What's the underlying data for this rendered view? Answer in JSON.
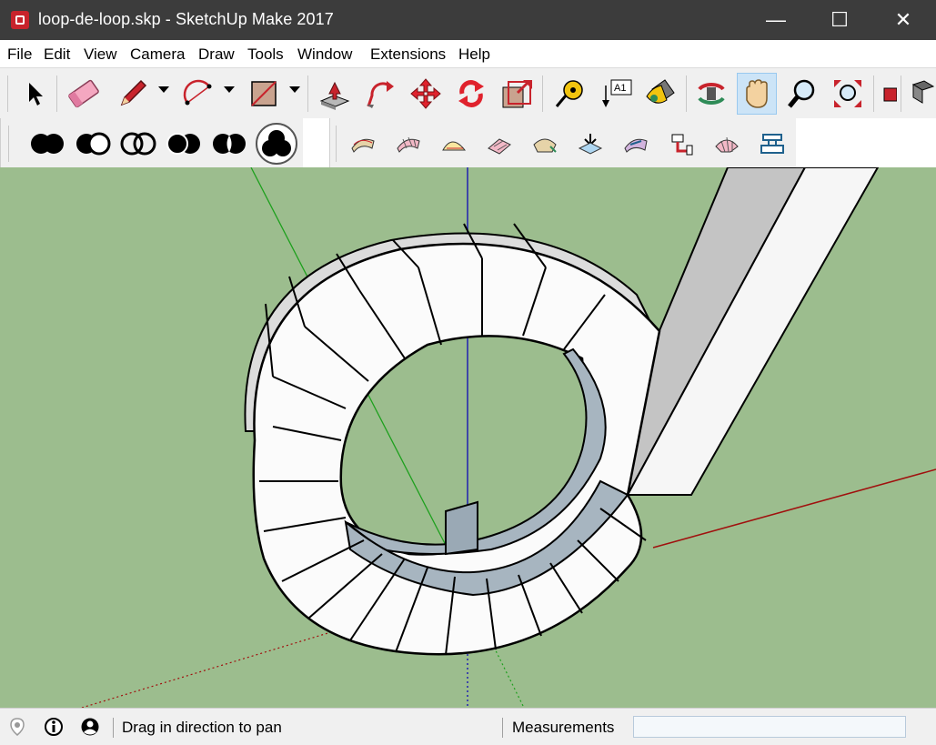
{
  "window": {
    "title": "loop-de-loop.skp - SketchUp Make 2017",
    "minimize_glyph": "—",
    "maximize_glyph": "☐",
    "close_glyph": "✕"
  },
  "menu": [
    "File",
    "Edit",
    "View",
    "Camera",
    "Draw",
    "Tools",
    "Window",
    "Extensions",
    "Help"
  ],
  "toolbar_main": [
    "select-icon",
    "eraser-icon",
    "pencil-icon",
    "arc-icon",
    "rectangle-icon",
    "push-pull-icon",
    "follow-me-icon",
    "move-icon",
    "rotate-icon",
    "offset-icon",
    "tape-measure-icon",
    "text-icon",
    "paint-bucket-icon",
    "orbit-icon",
    "pan-icon",
    "zoom-icon",
    "zoom-extents-icon"
  ],
  "active_tool": "pan-icon",
  "toolbar_solid": [
    "union-icon",
    "subtract-icon",
    "intersect-icon",
    "trim-icon",
    "split-icon",
    "outer-shell-icon"
  ],
  "toolbar_sandbox": [
    "from-contours-icon",
    "from-scratch-icon",
    "smoove-icon",
    "stamp-icon",
    "drape-icon",
    "add-detail-icon",
    "flip-edge-icon",
    "plumbing-icon",
    "mesh-icon",
    "align-icon"
  ],
  "text_tool_label": "A1",
  "status": {
    "message": "Drag in direction to pan",
    "measurements_label": "Measurements",
    "measurements_value": ""
  },
  "colors": {
    "title_bar": "#3c3c3c",
    "viewport_bg": "#9cbd8e",
    "active_tool_bg": "#cce4f7"
  }
}
